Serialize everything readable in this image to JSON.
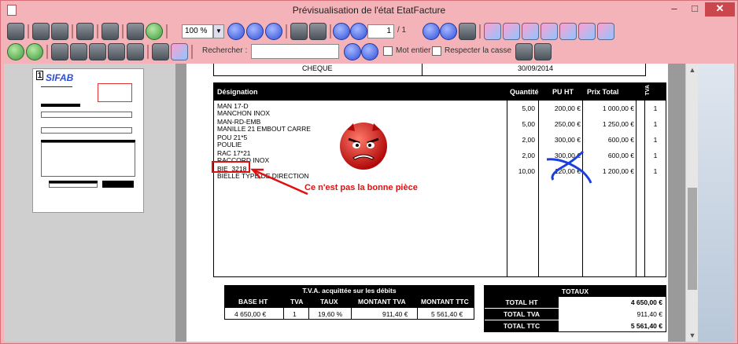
{
  "window": {
    "title": "Prévisualisation de l'état EtatFacture",
    "minimize": "–",
    "maximize": "□",
    "close": "✕"
  },
  "toolbar": {
    "zoom_value": "100 %",
    "page_current": "1",
    "page_total": "/ 1",
    "search_label": "Rechercher :",
    "search_value": "",
    "whole_word_label": "Mot entier",
    "match_case_label": "Respecter la casse"
  },
  "thumbnail": {
    "page_number": "1",
    "logo": "SIFAB"
  },
  "invoice": {
    "payment_mode": "CHEQUE",
    "due_date": "30/09/2014",
    "headers": {
      "designation": "Désignation",
      "quantity": "Quantité",
      "unit_price": "PU HT",
      "total": "Prix Total",
      "tva": "TVA"
    },
    "lines": [
      {
        "code": "MAN 17-D",
        "label": "MANCHON INOX",
        "qty": "5,00",
        "pu": "200,00 €",
        "total": "1 000,00 €",
        "tva": "1"
      },
      {
        "code": "MAN-RD-EMB",
        "label": "MANILLE 21 EMBOUT CARRE",
        "qty": "5,00",
        "pu": "250,00 €",
        "total": "1 250,00 €",
        "tva": "1"
      },
      {
        "code": "POU 21*5",
        "label": "POULIE",
        "qty": "2,00",
        "pu": "300,00 €",
        "total": "600,00 €",
        "tva": "1"
      },
      {
        "code": "RAC 17*21",
        "label": "RACCORD INOX",
        "qty": "2,00",
        "pu": "300,00 €",
        "total": "600,00 €",
        "tva": "1"
      },
      {
        "code": "BIE_3218",
        "label": "BIELLE TYPE DE DIRECTION",
        "qty": "10,00",
        "pu": "120,00 €",
        "total": "1 200,00 €",
        "tva": "1"
      }
    ],
    "vat_block": {
      "title": "T.V.A. acquittée sur les débits",
      "cols": [
        "BASE HT",
        "TVA",
        "TAUX",
        "MONTANT TVA",
        "MONTANT TTC"
      ],
      "values": [
        "4 650,00 €",
        "1",
        "19,60 %",
        "911,40 €",
        "5 561,40 €"
      ]
    },
    "totals": {
      "title": "TOTAUX",
      "rows": [
        {
          "label": "TOTAL HT",
          "value": "4 650,00 €"
        },
        {
          "label": "TOTAL TVA",
          "value": "911,40 €"
        },
        {
          "label": "TOTAL TTC",
          "value": "5 561,40 €"
        }
      ]
    }
  },
  "annotation": {
    "text": "Ce n'est pas la bonne pièce"
  },
  "colors": {
    "titlebar": "#f4b3b8",
    "accent_red": "#e01010",
    "pen_blue": "#1a3ee0"
  }
}
